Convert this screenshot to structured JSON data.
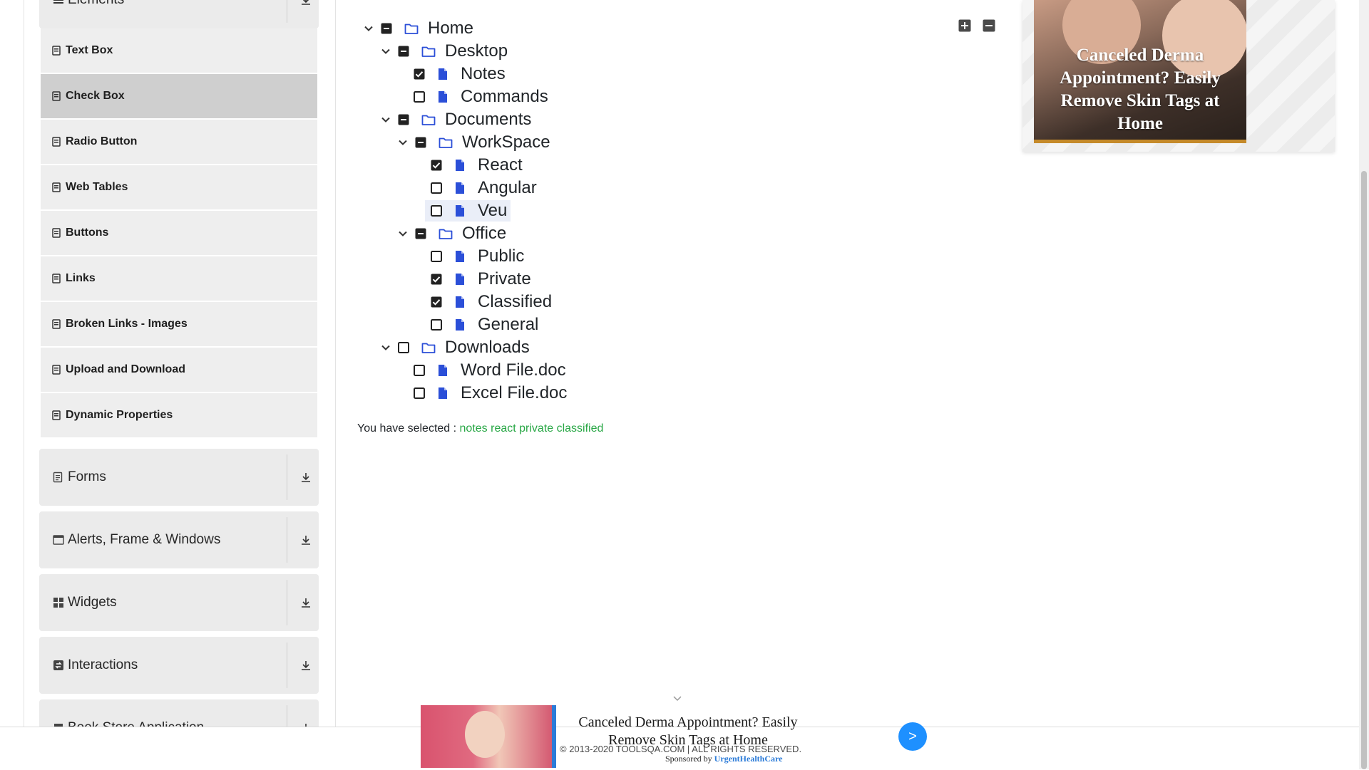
{
  "sidebar": {
    "elements_group": {
      "label": "Elements"
    },
    "items": [
      {
        "label": "Text Box"
      },
      {
        "label": "Check Box"
      },
      {
        "label": "Radio Button"
      },
      {
        "label": "Web Tables"
      },
      {
        "label": "Buttons"
      },
      {
        "label": "Links"
      },
      {
        "label": "Broken Links - Images"
      },
      {
        "label": "Upload and Download"
      },
      {
        "label": "Dynamic Properties"
      }
    ],
    "active_item": "Check Box",
    "groups": [
      {
        "label": "Forms",
        "icon": "document-icon"
      },
      {
        "label": "Alerts, Frame & Windows",
        "icon": "window-icon"
      },
      {
        "label": "Widgets",
        "icon": "grid-icon"
      },
      {
        "label": "Interactions",
        "icon": "interaction-icon"
      },
      {
        "label": "Book Store Application",
        "icon": "book-icon"
      }
    ]
  },
  "tree": {
    "nodes": [
      {
        "label": "Home",
        "state": "partial",
        "type": "folder"
      },
      {
        "label": "Desktop",
        "state": "partial",
        "type": "folder"
      },
      {
        "label": "Notes",
        "state": "checked",
        "type": "file"
      },
      {
        "label": "Commands",
        "state": "unchecked",
        "type": "file"
      },
      {
        "label": "Documents",
        "state": "partial",
        "type": "folder"
      },
      {
        "label": "WorkSpace",
        "state": "partial",
        "type": "folder"
      },
      {
        "label": "React",
        "state": "checked",
        "type": "file"
      },
      {
        "label": "Angular",
        "state": "unchecked",
        "type": "file"
      },
      {
        "label": "Veu",
        "state": "unchecked",
        "type": "file"
      },
      {
        "label": "Office",
        "state": "partial",
        "type": "folder"
      },
      {
        "label": "Public",
        "state": "unchecked",
        "type": "file"
      },
      {
        "label": "Private",
        "state": "checked",
        "type": "file"
      },
      {
        "label": "Classified",
        "state": "checked",
        "type": "file"
      },
      {
        "label": "General",
        "state": "unchecked",
        "type": "file"
      },
      {
        "label": "Downloads",
        "state": "unchecked",
        "type": "folder"
      },
      {
        "label": "Word File.doc",
        "state": "unchecked",
        "type": "file"
      },
      {
        "label": "Excel File.doc",
        "state": "unchecked",
        "type": "file"
      }
    ]
  },
  "result": {
    "prefix": "You have selected :",
    "values": "notes react private classified"
  },
  "ad_right": {
    "title": "Canceled Derma Appointment? Easily Remove Skin Tags at Home"
  },
  "ad_bottom": {
    "title": "Canceled Derma Appointment? Easily Remove Skin Tags at Home",
    "sponsor_prefix": "Sponsored by",
    "sponsor_name": "UrgentHealthCare",
    "button": ">"
  },
  "footer": {
    "text": "© 2013-2020 TOOLSQA.COM | ALL RIGHTS RESERVED."
  },
  "colors": {
    "accent_blue": "#2b4fd8",
    "selected_green": "#28a745"
  }
}
